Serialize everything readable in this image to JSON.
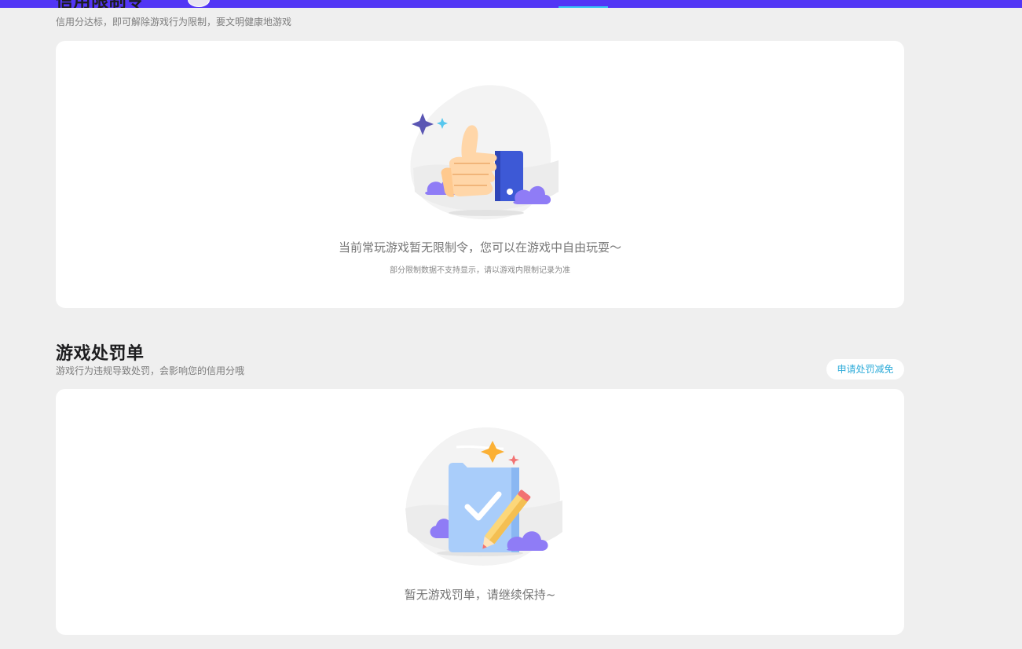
{
  "credit_section": {
    "title": "信用限制令",
    "subtitle": "信用分达标，即可解除游戏行为限制，要文明健康地游戏",
    "empty_text": "当前常玩游戏暂无限制令，您可以在游戏中自由玩耍～",
    "note": "部分限制数据不支持显示，请以游戏内限制记录为准",
    "illustration_icon": "thumbs-up-icon"
  },
  "penalty_section": {
    "title": "游戏处罚单",
    "subtitle": "游戏行为违规导致处罚，会影响您的信用分哦",
    "appeal_label": "申请处罚减免",
    "empty_text": "暂无游戏罚单，请继续保持~",
    "illustration_icon": "document-check-icon"
  },
  "colors": {
    "accent_bar": "#5236f5",
    "tab_indicator": "#36c5f4",
    "link": "#2dabd9",
    "page_background": "#efefef"
  }
}
